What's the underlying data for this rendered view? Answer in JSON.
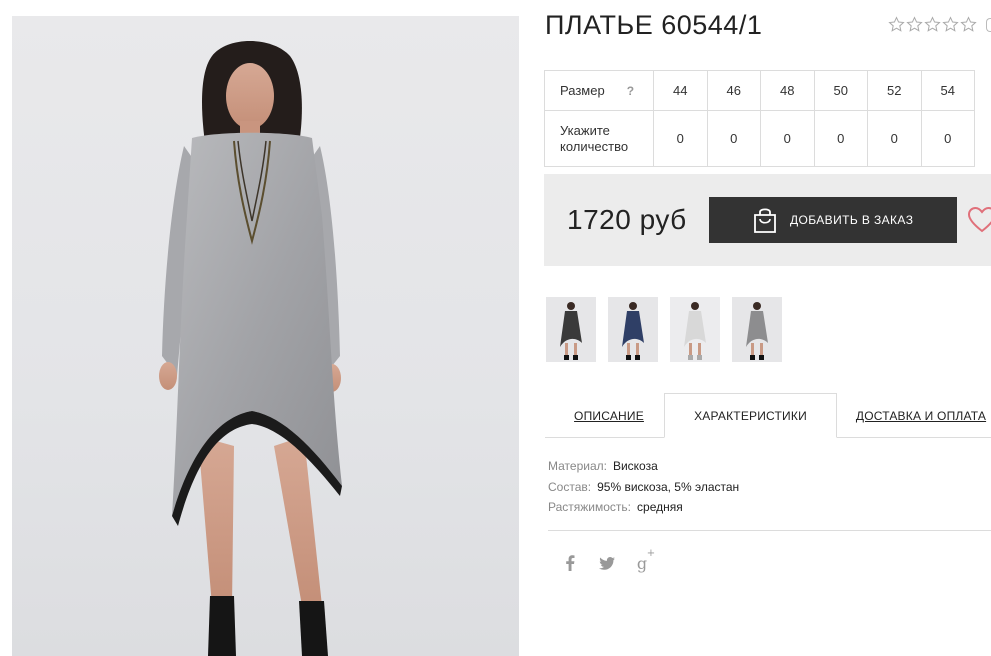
{
  "product": {
    "title": "ПЛАТЬЕ 60544/1",
    "rating_stars": 5,
    "rating_filled": 0
  },
  "sizes": {
    "size_label": "Размер",
    "help_mark": "?",
    "qty_label": "Укажите количество",
    "values": [
      "44",
      "46",
      "48",
      "50",
      "52",
      "54"
    ],
    "quantities": [
      "0",
      "0",
      "0",
      "0",
      "0",
      "0"
    ]
  },
  "purchase": {
    "price": "1720 руб",
    "order_label": "ДОБАВИТЬ В ЗАКАЗ"
  },
  "thumbnails": [
    {
      "name": "thumb-black-dress",
      "color": "#3a3a3a"
    },
    {
      "name": "thumb-blue-dress",
      "color": "#2f3f66"
    },
    {
      "name": "thumb-white-dress",
      "color": "#d8d8d8"
    },
    {
      "name": "thumb-grey-dress",
      "color": "#8d8d8f"
    }
  ],
  "tabs": {
    "description": "ОПИСАНИЕ",
    "characteristics": "ХАРАКТЕРИСТИКИ",
    "shipping": "ДОСТАВКА И ОПЛАТА",
    "active": "characteristics"
  },
  "specs": [
    {
      "key": "Материал:",
      "value": "Вискоза"
    },
    {
      "key": "Состав:",
      "value": "95% вискоза, 5% эластан"
    },
    {
      "key": "Растяжимость:",
      "value": "средняя"
    }
  ],
  "social": [
    "facebook-icon",
    "twitter-icon",
    "google-plus-icon"
  ],
  "colors": {
    "button_bg": "#333333",
    "panel_bg": "#ececec",
    "border": "#dcdcdc",
    "heart": "#e0707a",
    "muted_text": "#888888"
  }
}
